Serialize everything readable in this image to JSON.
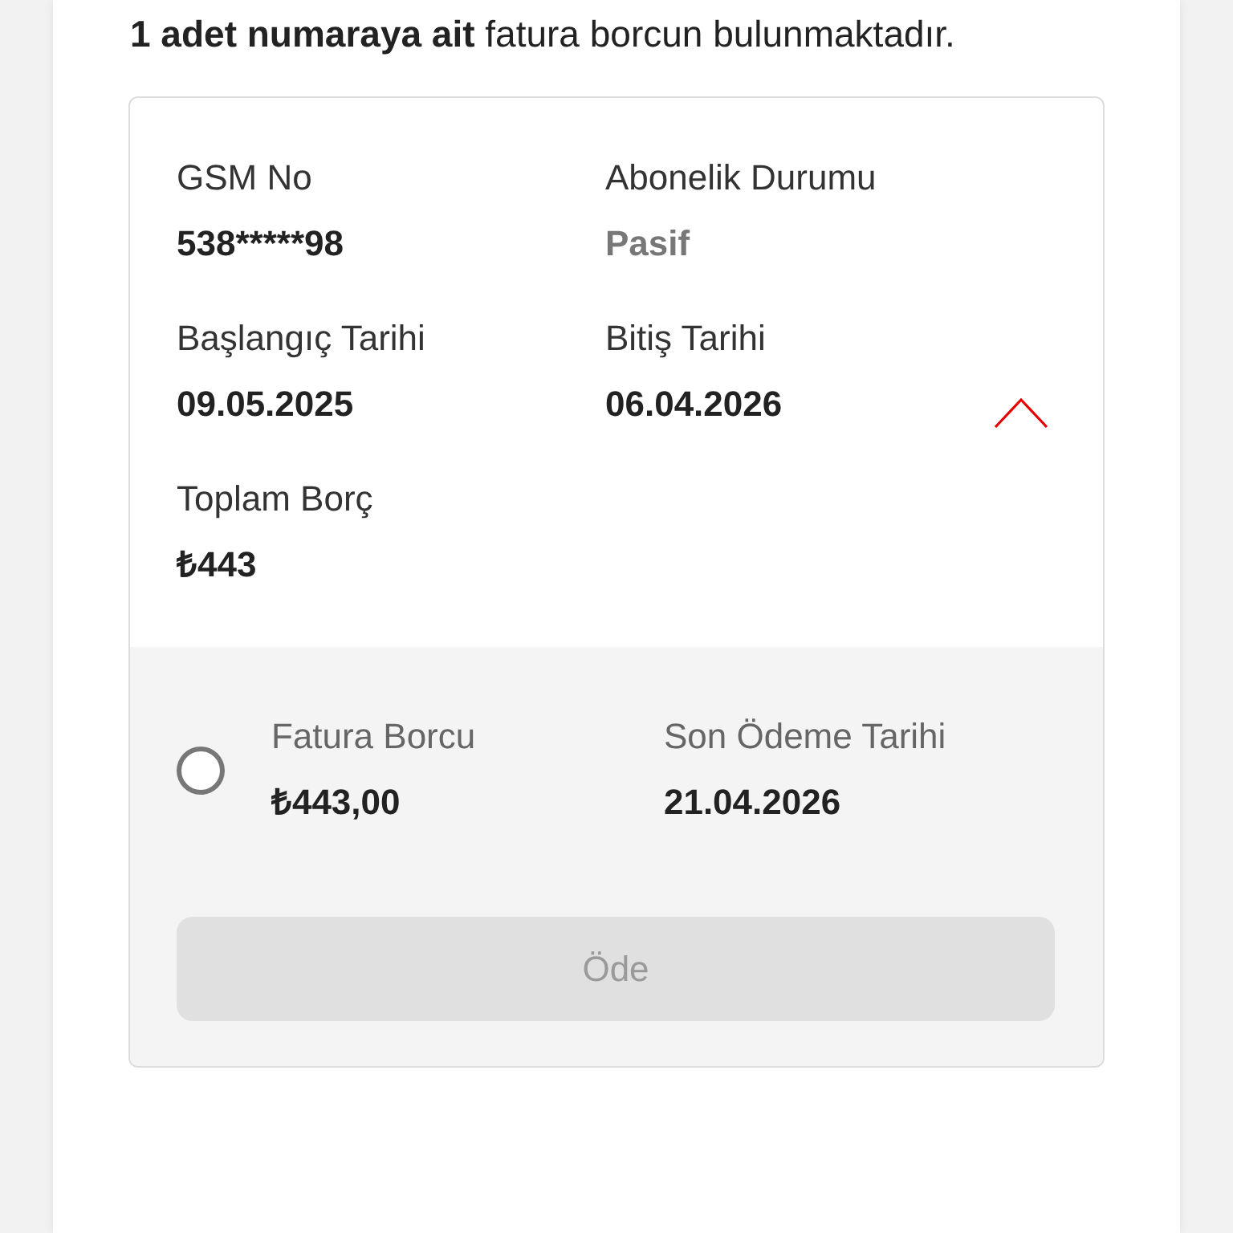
{
  "summary": "**1 adet numaraya ait** fatura borcun bulunmaktadır.",
  "line_card": {
    "expanded": true,
    "fields": [
      {
        "label": "GSM No",
        "value": "538*****98",
        "kind": "plain"
      },
      {
        "label": "Abonelik Durumu",
        "value": "Pasif",
        "kind": "status"
      },
      {
        "label": "Başlangıç Tarihi",
        "value": "09.05.2025",
        "kind": "plain"
      },
      {
        "label": "Bitiş Tarihi",
        "value": "06.04.2026",
        "kind": "plain"
      },
      {
        "label": "Toplam Borç",
        "value": "₺443",
        "kind": "plain"
      }
    ],
    "bill": {
      "selected": false,
      "fields": [
        {
          "label": "Fatura Borcu",
          "value": "₺443,00"
        },
        {
          "label": "Son Ödeme Tarihi",
          "value": "21.04.2026"
        }
      ]
    },
    "pay_button": {
      "label": "Öde",
      "disabled": true
    }
  }
}
